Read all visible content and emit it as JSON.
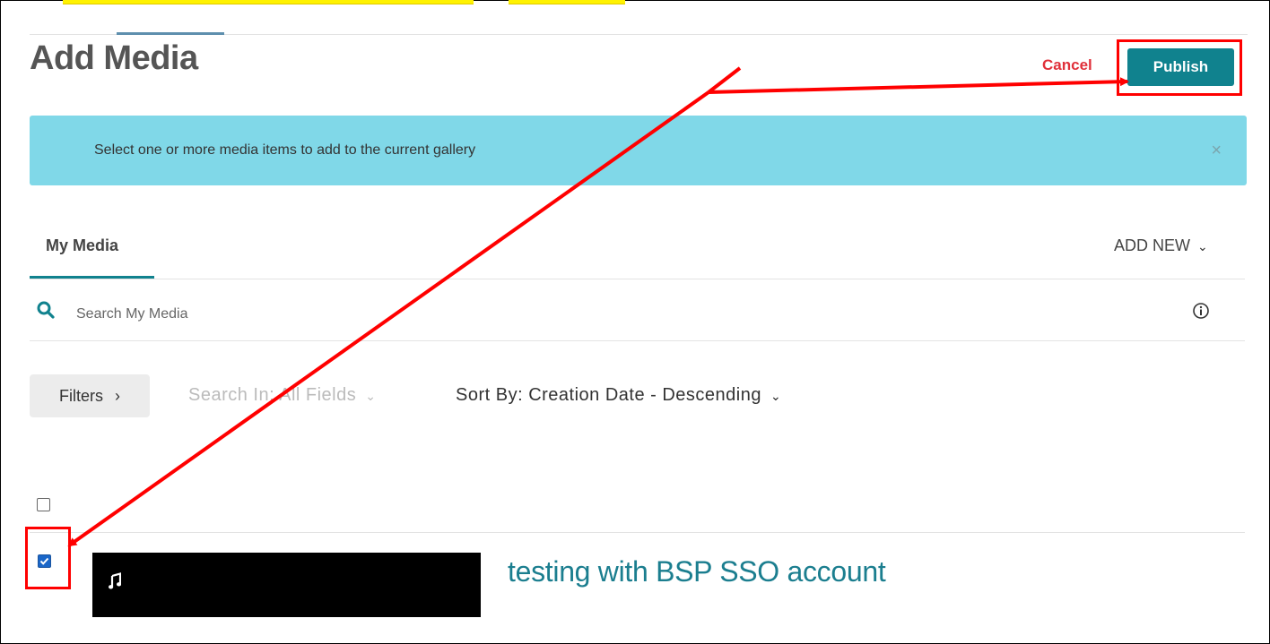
{
  "header": {
    "title": "Add Media",
    "cancel_label": "Cancel",
    "publish_label": "Publish"
  },
  "banner": {
    "message": "Select one or more media items to add to the current gallery",
    "close_glyph": "×"
  },
  "tabs": {
    "my_media_label": "My Media",
    "add_new_label": "ADD NEW"
  },
  "search": {
    "placeholder": "Search My Media",
    "icon": "search-icon"
  },
  "filters": {
    "filters_label": "Filters",
    "search_in_label": "Search In: All Fields",
    "sort_by_label": "Sort By: Creation Date - Descending"
  },
  "media": {
    "items": [
      {
        "title": "testing with BSP SSO account",
        "selected": true,
        "type_icon": "music-note-icon"
      }
    ]
  },
  "colors": {
    "accent": "#10828e",
    "cancel": "#e0303a",
    "banner": "#80d8e8",
    "annotation": "#ff0000",
    "highlight": "#fff200"
  }
}
